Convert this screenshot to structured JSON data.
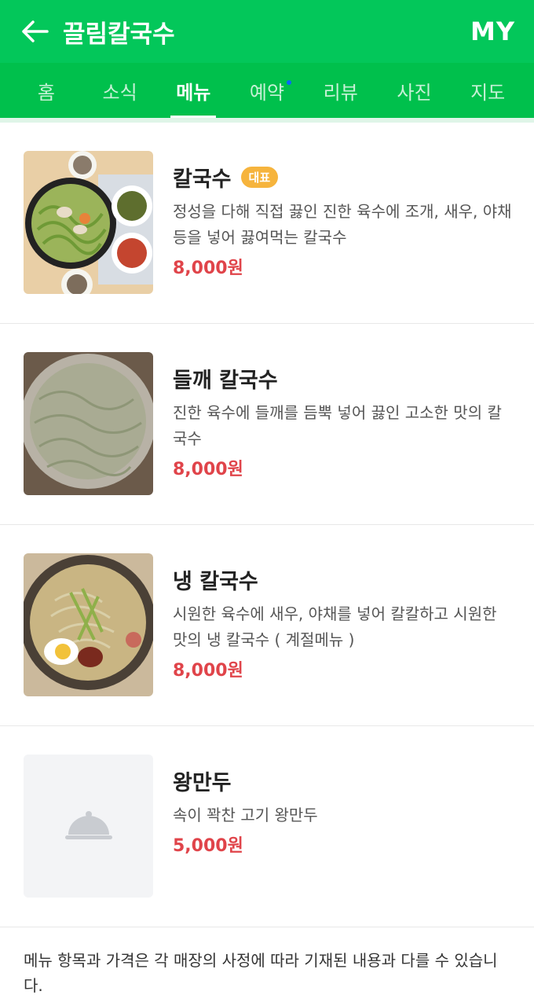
{
  "header": {
    "title": "끌림칼국수",
    "my_label": "MY"
  },
  "tabs": [
    {
      "label": "홈"
    },
    {
      "label": "소식"
    },
    {
      "label": "메뉴"
    },
    {
      "label": "예약"
    },
    {
      "label": "리뷰"
    },
    {
      "label": "사진"
    },
    {
      "label": "지도"
    }
  ],
  "menu": [
    {
      "name": "칼국수",
      "badge": "대표",
      "desc": "정성을 다해 직접 끓인 진한 육수에 조개, 새우, 야채등을 넣어 끓여먹는 칼국수",
      "price": "8,000원"
    },
    {
      "name": "들깨 칼국수",
      "desc": "진한 육수에 들깨를 듬뿍 넣어 끓인 고소한 맛의 칼국수",
      "price": "8,000원"
    },
    {
      "name": "냉 칼국수",
      "desc": "시원한 육수에 새우, 야채를 넣어 칼칼하고 시원한 맛의 냉 칼국수 ( 계절메뉴 )",
      "price": "8,000원"
    },
    {
      "name": "왕만두",
      "desc": "속이 꽉찬 고기 왕만두",
      "price": "5,000원"
    }
  ],
  "notice": "메뉴 항목과 가격은 각 매장의 사정에 따라 기재된 내용과 다를 수 있습니다.",
  "colors": {
    "brand": "#03c75a",
    "price": "#e0444a",
    "badge": "#f6b43d"
  }
}
